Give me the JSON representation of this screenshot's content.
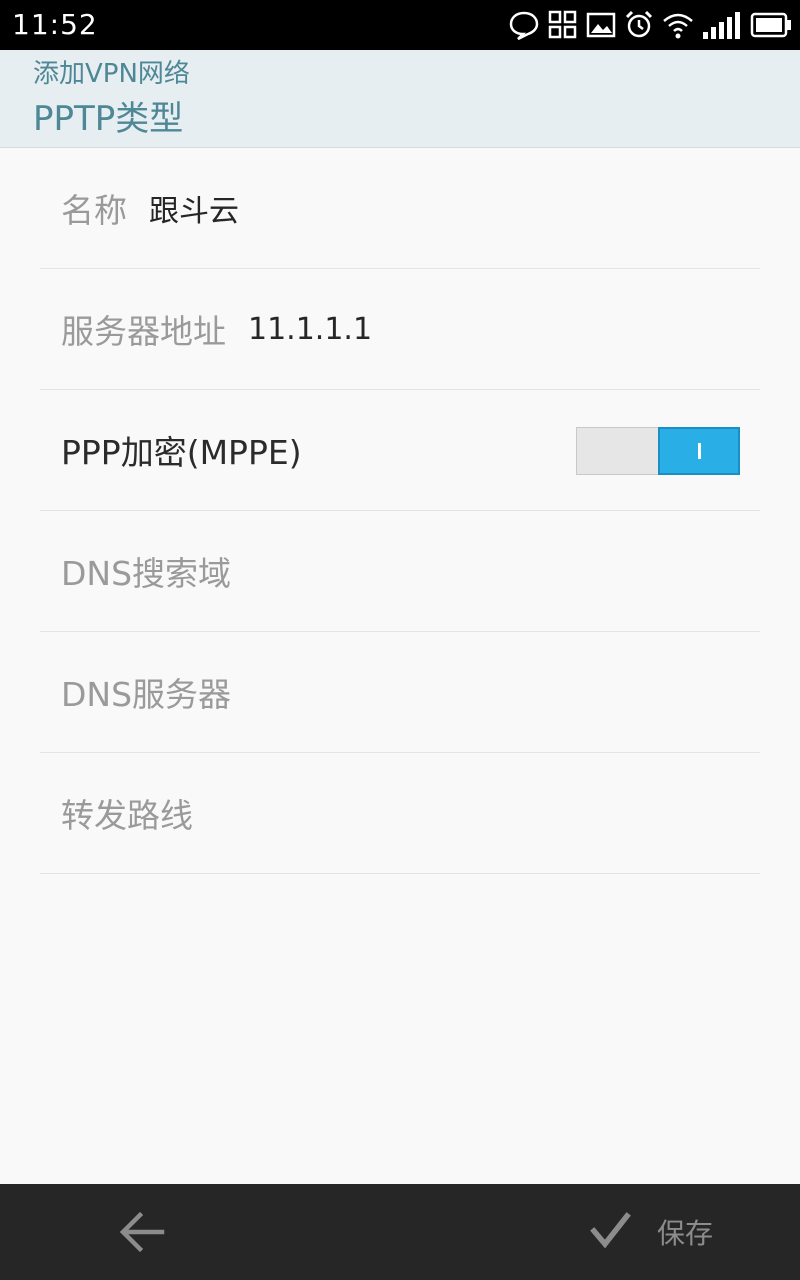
{
  "status_bar": {
    "time": "11:52",
    "icons": [
      "chat-bubble-icon",
      "apps-icon",
      "image-icon",
      "alarm-icon",
      "wifi-icon",
      "signal-icon",
      "battery-icon"
    ]
  },
  "header": {
    "subtitle": "添加VPN网络",
    "title": "PPTP类型"
  },
  "form": {
    "name": {
      "label": "名称",
      "value": "跟斗云"
    },
    "server": {
      "label": "服务器地址",
      "value": "11.1.1.1"
    },
    "ppp_encryption": {
      "label": "PPP加密(MPPE)",
      "enabled": true
    },
    "dns_search": {
      "label": "DNS搜索域"
    },
    "dns_server": {
      "label": "DNS服务器"
    },
    "forward_route": {
      "label": "转发路线"
    }
  },
  "bottom_bar": {
    "back_icon": "back-arrow-icon",
    "save_icon": "checkmark-icon",
    "save_label": "保存"
  },
  "colors": {
    "header_bg": "#e6eef1",
    "header_text": "#4e8795",
    "toggle_on": "#2aaee6",
    "bottom_bar_bg": "#262626"
  }
}
